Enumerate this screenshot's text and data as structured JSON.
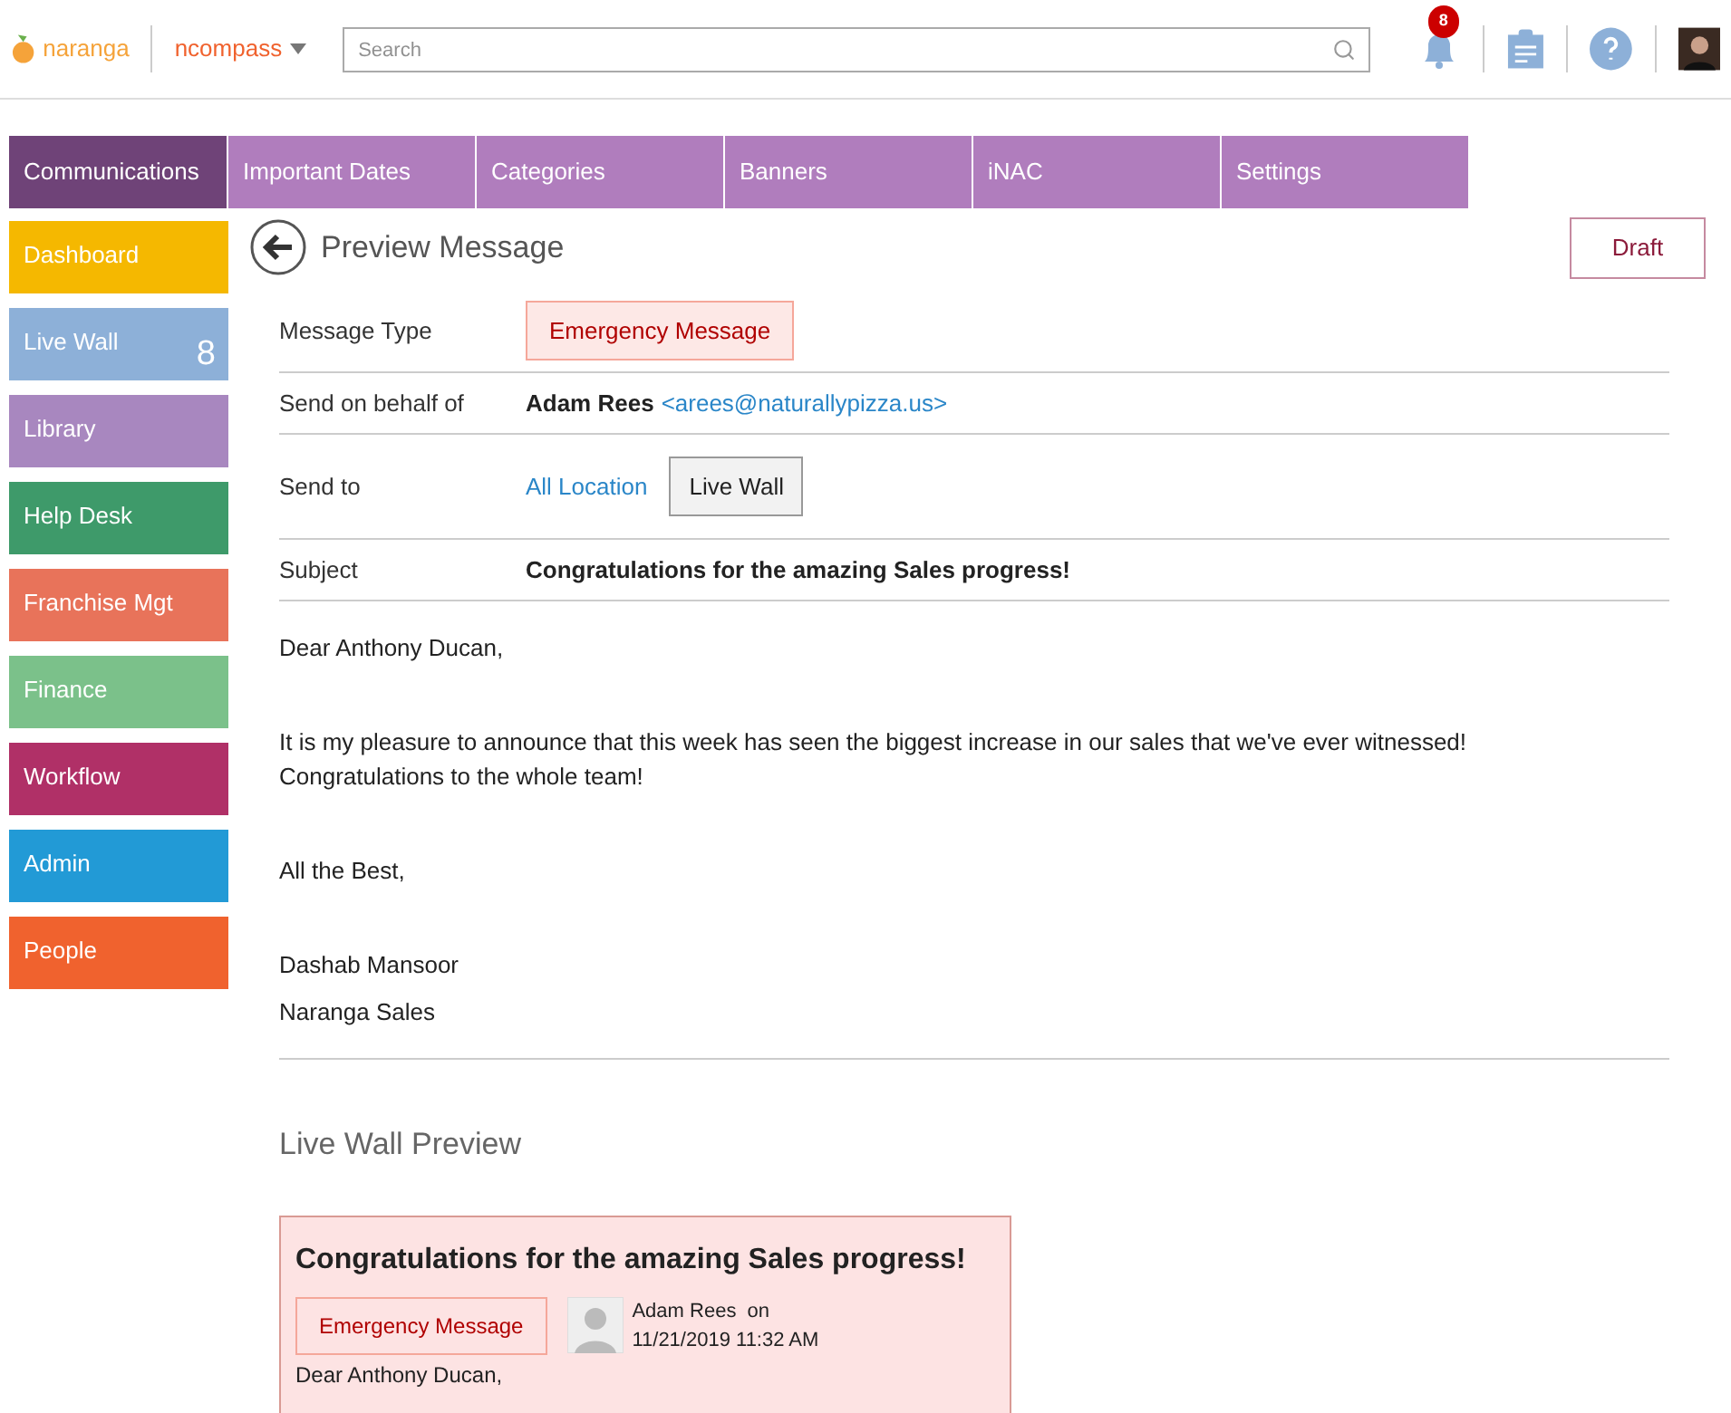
{
  "header": {
    "logo": "naranga",
    "product": "ncompass",
    "search": {
      "placeholder": "Search"
    },
    "notifications": "8"
  },
  "tabs": [
    {
      "label": "Communications",
      "selected": true
    },
    {
      "label": "Important Dates",
      "selected": false
    },
    {
      "label": "Categories",
      "selected": false
    },
    {
      "label": "Banners",
      "selected": false
    },
    {
      "label": "iNAC",
      "selected": false
    },
    {
      "label": "Settings",
      "selected": false
    }
  ],
  "sidebar": {
    "items": [
      {
        "label": "Dashboard",
        "color": "#f5b800"
      },
      {
        "label": "Live Wall",
        "color": "#8db0d8",
        "count": "8"
      },
      {
        "label": "Library",
        "color": "#a887bf"
      },
      {
        "label": "Help Desk",
        "color": "#3e9a6a"
      },
      {
        "label": "Franchise Mgt",
        "color": "#e8735a"
      },
      {
        "label": "Finance",
        "color": "#7bc18a"
      },
      {
        "label": "Workflow",
        "color": "#b03067"
      },
      {
        "label": "Admin",
        "color": "#229ad6"
      },
      {
        "label": "People",
        "color": "#f0622e"
      }
    ]
  },
  "page": {
    "title": "Preview Message",
    "status": "Draft",
    "fields": [
      {
        "label": "Message Type",
        "kind": "badge",
        "value": "Emergency Message"
      },
      {
        "label": "Send on behalf of",
        "kind": "sender",
        "name": "Adam Rees",
        "email": "<arees@naturallypizza.us>"
      },
      {
        "label": "Send to",
        "kind": "targets",
        "link": "All Location",
        "chip": "Live Wall"
      },
      {
        "label": "Subject",
        "kind": "text",
        "value": "Congratulations for the amazing Sales progress!"
      }
    ],
    "body": [
      "Dear Anthony Ducan,",
      "It is my pleasure to announce that this week has seen the biggest increase in our sales that we've ever witnessed! Congratulations to the whole team!",
      "All the Best,",
      "Dashab Mansoor",
      "Naranga Sales"
    ],
    "preview": {
      "heading": "Live Wall Preview",
      "title": "Congratulations for the amazing Sales progress!",
      "type": "Emergency Message",
      "author": "Adam Rees  on",
      "date": "11/21/2019 11:32 AM",
      "body": "Dear Anthony Ducan,"
    }
  }
}
